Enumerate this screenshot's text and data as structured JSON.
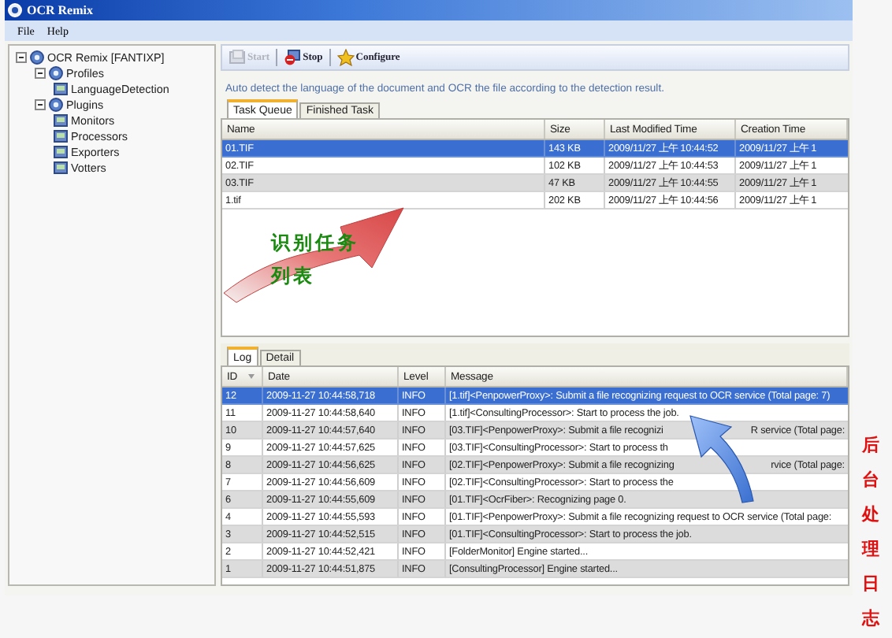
{
  "window": {
    "title": "OCR Remix"
  },
  "menu": [
    "File",
    "Help"
  ],
  "tree": [
    {
      "label": "OCR Remix [FANTIXP]",
      "expanded": true,
      "children": [
        {
          "label": "Profiles",
          "expanded": true,
          "children": [
            {
              "label": "LanguageDetection"
            }
          ]
        },
        {
          "label": "Plugins",
          "expanded": true,
          "children": [
            {
              "label": "Monitors"
            },
            {
              "label": "Processors"
            },
            {
              "label": "Exporters"
            },
            {
              "label": "Votters"
            }
          ]
        }
      ]
    }
  ],
  "toolbar": [
    {
      "label": "Start",
      "disabled": true
    },
    {
      "label": "Stop",
      "disabled": false
    },
    {
      "label": "Configure",
      "disabled": false
    }
  ],
  "description": "Auto detect the language of the document and OCR the file according to the detection result.",
  "task_tabs": [
    {
      "label": "Task Queue",
      "selected": true
    },
    {
      "label": "Finished Task",
      "selected": false
    }
  ],
  "task_table": {
    "columns": [
      "Name",
      "Size",
      "Last Modified Time",
      "Creation Time"
    ],
    "rows": [
      {
        "cells": [
          "01.TIF",
          "143 KB",
          "2009/11/27 上午 10:44:52",
          "2009/11/27 上午 1"
        ],
        "selected": true
      },
      {
        "cells": [
          "02.TIF",
          "102 KB",
          "2009/11/27 上午 10:44:53",
          "2009/11/27 上午 1"
        ],
        "selected": false
      },
      {
        "cells": [
          "03.TIF",
          "47 KB",
          "2009/11/27 上午 10:44:55",
          "2009/11/27 上午 1"
        ],
        "selected": false
      },
      {
        "cells": [
          "1.tif",
          "202 KB",
          "2009/11/27 上午 10:44:56",
          "2009/11/27 上午 1"
        ],
        "selected": false
      }
    ]
  },
  "task_callout": "识别任务列表",
  "log_tabs": [
    {
      "label": "Log",
      "selected": true
    },
    {
      "label": "Detail",
      "selected": false
    }
  ],
  "log_table": {
    "columns": [
      "ID",
      "Date",
      "Level",
      "Message"
    ],
    "rows": [
      {
        "cells": [
          "12",
          "2009-11-27 10:44:58,718",
          "INFO",
          "[1.tif]<PenpowerProxy>: Submit a file recognizing request to OCR service (Total page: 7)"
        ],
        "selected": true
      },
      {
        "cells": [
          "11",
          "2009-11-27 10:44:58,640",
          "INFO",
          "[1.tif]<ConsultingProcessor>: Start to process the job."
        ],
        "selected": false
      },
      {
        "cells": [
          "10",
          "2009-11-27 10:44:57,640",
          "INFO",
          "[03.TIF]<PenpowerProxy>: Submit a file recognizi"
        ],
        "message_end": "R service (Total page:",
        "selected": false
      },
      {
        "cells": [
          "9",
          "2009-11-27 10:44:57,625",
          "INFO",
          "[03.TIF]<ConsultingProcessor>: Start to process th"
        ],
        "selected": false
      },
      {
        "cells": [
          "8",
          "2009-11-27 10:44:56,625",
          "INFO",
          "[02.TIF]<PenpowerProxy>: Submit a file recognizing"
        ],
        "message_end": "rvice (Total page:",
        "selected": false
      },
      {
        "cells": [
          "7",
          "2009-11-27 10:44:56,609",
          "INFO",
          "[02.TIF]<ConsultingProcessor>: Start to process the"
        ],
        "selected": false
      },
      {
        "cells": [
          "6",
          "2009-11-27 10:44:55,609",
          "INFO",
          "[01.TIF]<OcrFiber>: Recognizing page 0."
        ],
        "selected": false
      },
      {
        "cells": [
          "4",
          "2009-11-27 10:44:55,593",
          "INFO",
          "[01.TIF]<PenpowerProxy>: Submit a file recognizing request to OCR service (Total page:"
        ],
        "selected": false
      },
      {
        "cells": [
          "3",
          "2009-11-27 10:44:52,515",
          "INFO",
          "[01.TIF]<ConsultingProcessor>: Start to process the job."
        ],
        "selected": false
      },
      {
        "cells": [
          "2",
          "2009-11-27 10:44:52,421",
          "INFO",
          "[FolderMonitor] Engine started..."
        ],
        "selected": false
      },
      {
        "cells": [
          "1",
          "2009-11-27 10:44:51,875",
          "INFO",
          "[ConsultingProcessor] Engine started..."
        ],
        "selected": false
      }
    ]
  },
  "log_callout": "后台处理日志"
}
